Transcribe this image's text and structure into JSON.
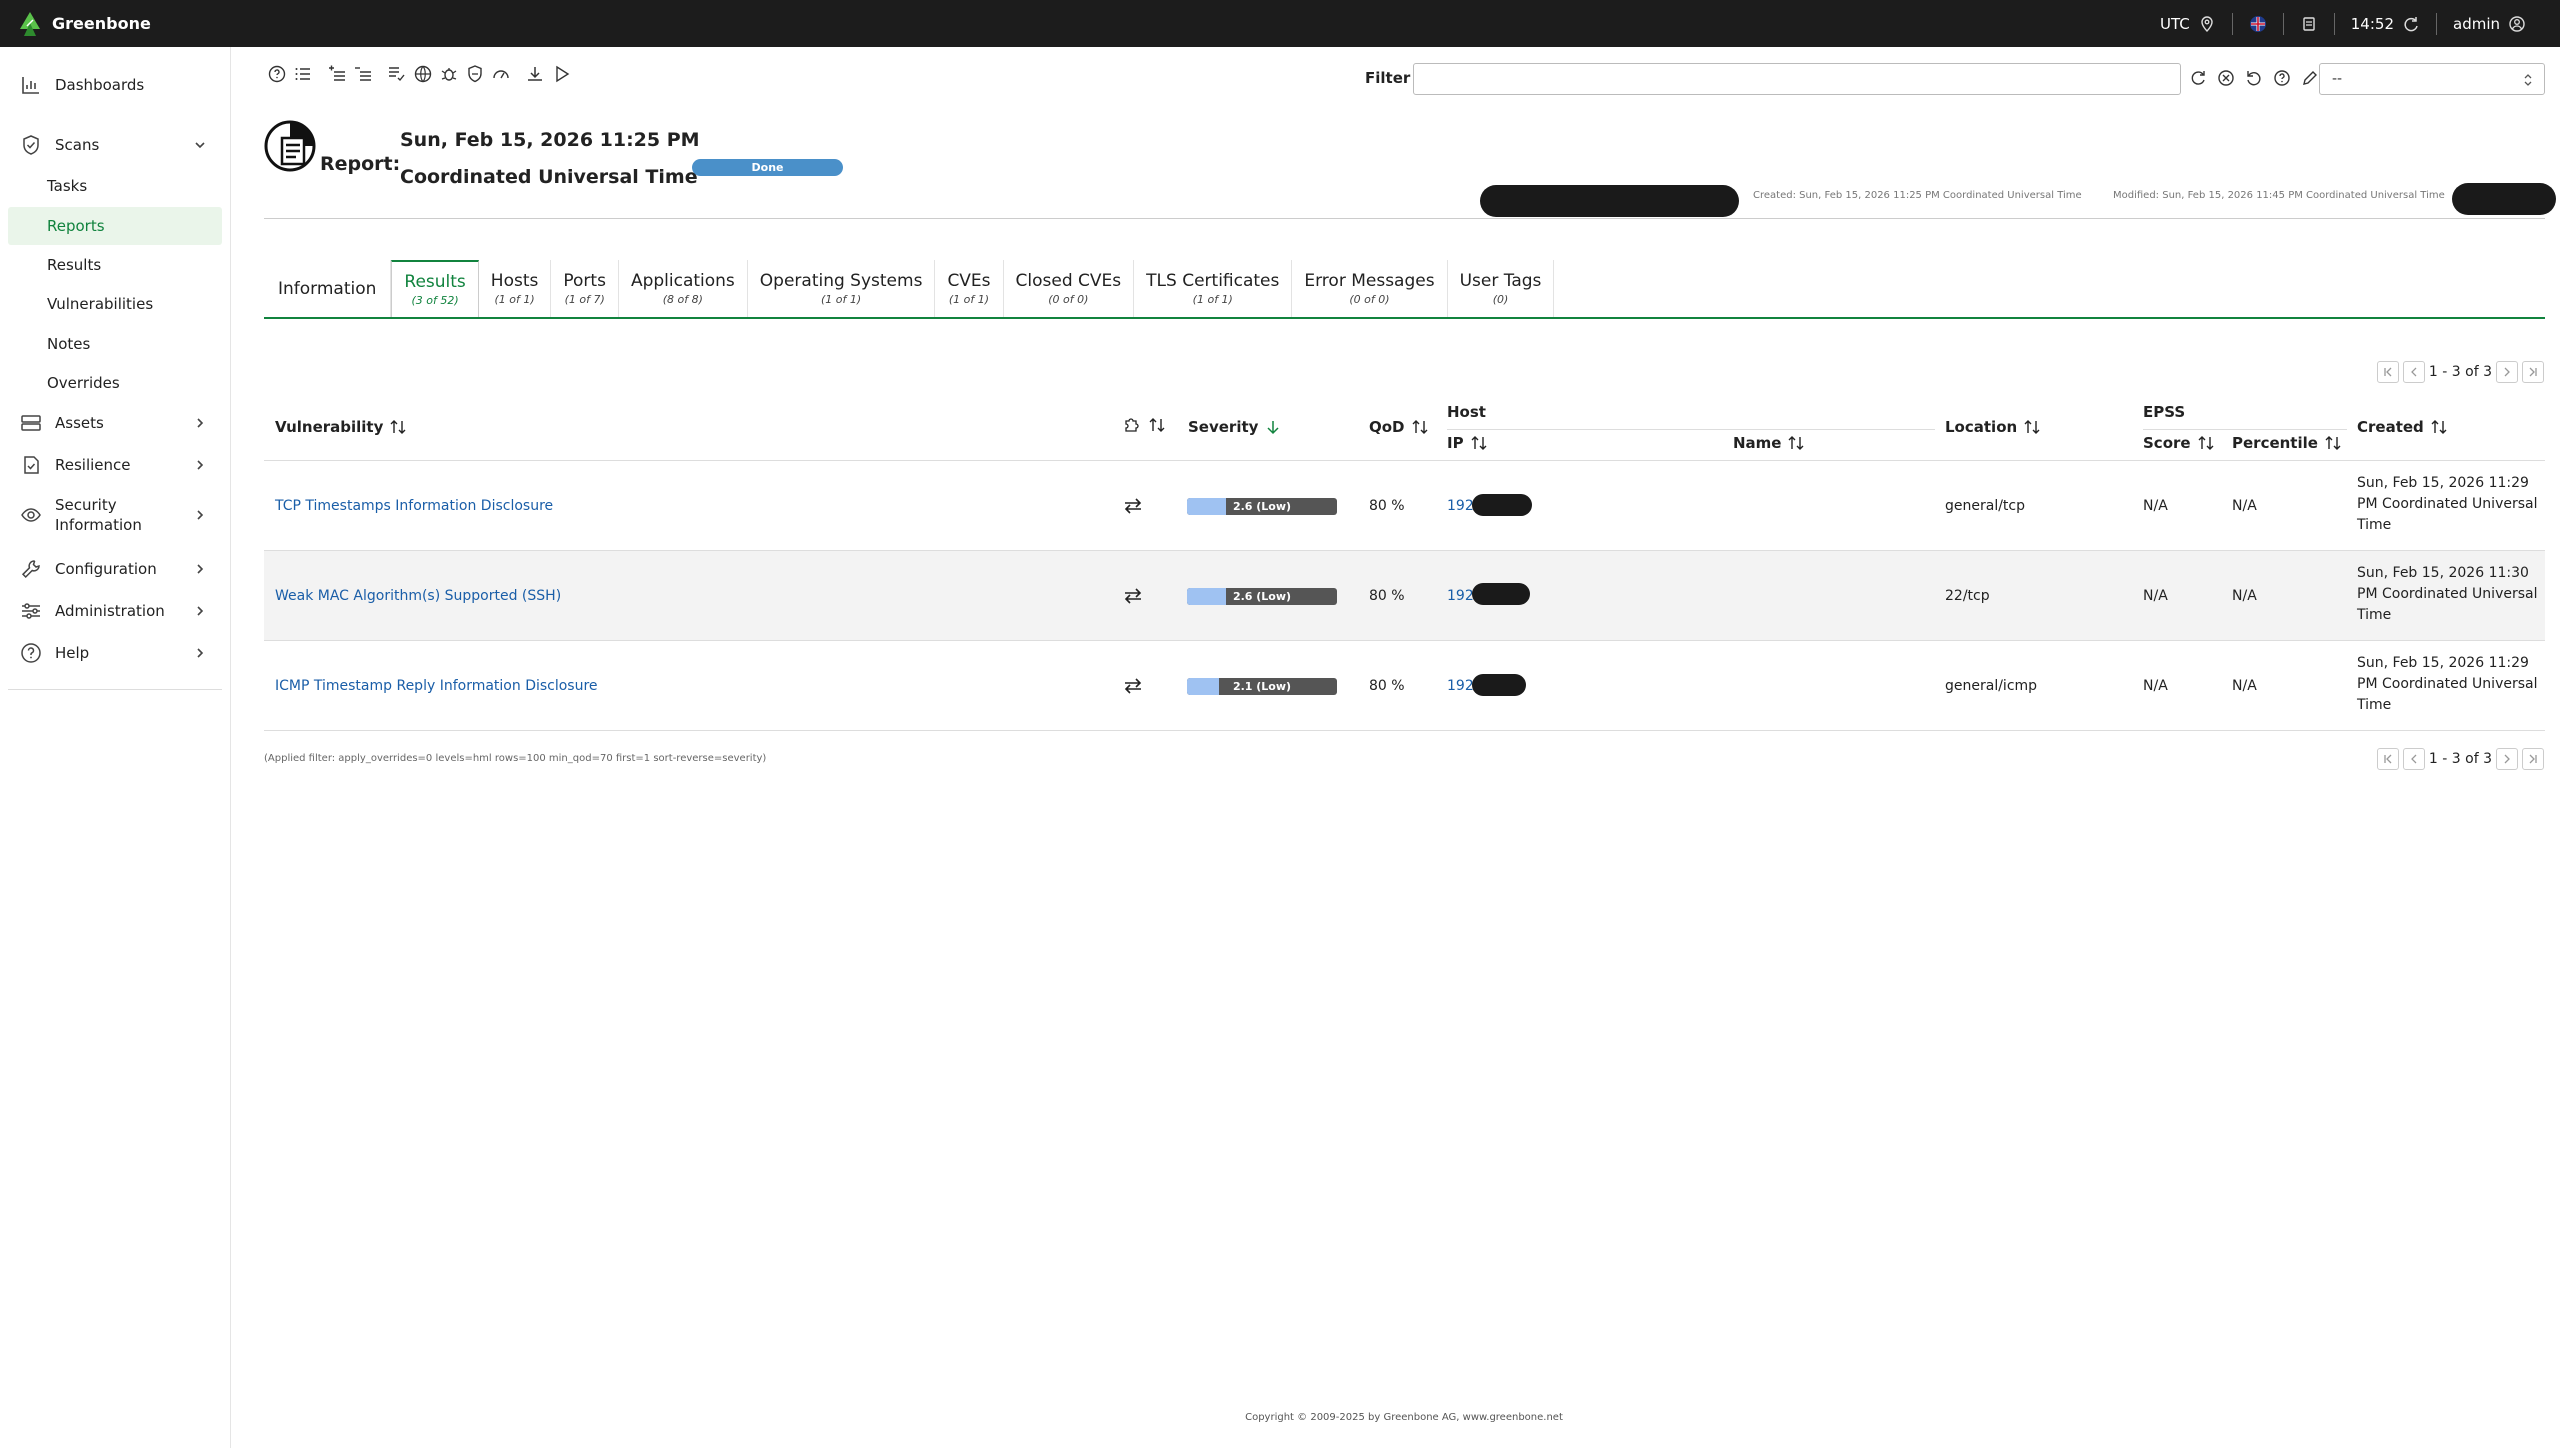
{
  "app": {
    "name": "Greenbone",
    "timezone": "UTC",
    "time": "14:52",
    "user": "admin"
  },
  "sidebar": {
    "dashboards": "Dashboards",
    "scans": "Scans",
    "scans_items": [
      "Tasks",
      "Reports",
      "Results",
      "Vulnerabilities",
      "Notes",
      "Overrides"
    ],
    "assets": "Assets",
    "resilience": "Resilience",
    "security_info_line1": "Security",
    "security_info_line2": "Information",
    "configuration": "Configuration",
    "administration": "Administration",
    "help": "Help"
  },
  "filter": {
    "label": "Filter",
    "value": "",
    "select_value": "--"
  },
  "report": {
    "label": "Report:",
    "date": "Sun, Feb 15, 2026 11:25 PM",
    "timezone": "Coordinated Universal Time",
    "status": "Done",
    "status_progress": 100,
    "created": "Created: Sun, Feb 15, 2026 11:25 PM Coordinated Universal Time",
    "modified": "Modified: Sun, Feb 15, 2026 11:45 PM Coordinated Universal Time"
  },
  "tabs": [
    {
      "label": "Information",
      "count": ""
    },
    {
      "label": "Results",
      "count": "(3 of 52)"
    },
    {
      "label": "Hosts",
      "count": "(1 of 1)"
    },
    {
      "label": "Ports",
      "count": "(1 of 7)"
    },
    {
      "label": "Applications",
      "count": "(8 of 8)"
    },
    {
      "label": "Operating Systems",
      "count": "(1 of 1)"
    },
    {
      "label": "CVEs",
      "count": "(1 of 1)"
    },
    {
      "label": "Closed CVEs",
      "count": "(0 of 0)"
    },
    {
      "label": "TLS Certificates",
      "count": "(1 of 1)"
    },
    {
      "label": "Error Messages",
      "count": "(0 of 0)"
    },
    {
      "label": "User Tags",
      "count": "(0)"
    }
  ],
  "pagination": {
    "text": "1 - 3 of 3"
  },
  "table": {
    "headers": {
      "vulnerability": "Vulnerability",
      "severity": "Severity",
      "qod": "QoD",
      "host": "Host",
      "ip": "IP",
      "name": "Name",
      "location": "Location",
      "epss": "EPSS",
      "score": "Score",
      "percentile": "Percentile",
      "created": "Created"
    },
    "rows": [
      {
        "vulnerability": "TCP Timestamps Information Disclosure",
        "severity_value": 2.6,
        "severity_label": "2.6 (Low)",
        "qod": "80 %",
        "ip": "192",
        "location": "general/tcp",
        "epss_score": "N/A",
        "epss_percentile": "N/A",
        "created": "Sun, Feb 15, 2026 11:29 PM Coordinated Universal Time"
      },
      {
        "vulnerability": "Weak MAC Algorithm(s) Supported (SSH)",
        "severity_value": 2.6,
        "severity_label": "2.6 (Low)",
        "qod": "80 %",
        "ip": "192",
        "location": "22/tcp",
        "epss_score": "N/A",
        "epss_percentile": "N/A",
        "created": "Sun, Feb 15, 2026 11:30 PM Coordinated Universal Time"
      },
      {
        "vulnerability": "ICMP Timestamp Reply Information Disclosure",
        "severity_value": 2.1,
        "severity_label": "2.1 (Low)",
        "qod": "80 %",
        "ip": "192",
        "location": "general/icmp",
        "epss_score": "N/A",
        "epss_percentile": "N/A",
        "created": "Sun, Feb 15, 2026 11:29 PM Coordinated Universal Time"
      }
    ]
  },
  "applied_filter": "(Applied filter: apply_overrides=0 levels=hml rows=100 min_qod=70 first=1 sort-reverse=severity)",
  "footer": "Copyright © 2009-2025 by Greenbone AG, www.greenbone.net",
  "colors": {
    "topbar": "#1c1c1c",
    "accent_green": "#11833e",
    "link_blue": "#1a5ea8",
    "severity_low": "#9fc2f2",
    "status_blue": "#4a90c9"
  }
}
